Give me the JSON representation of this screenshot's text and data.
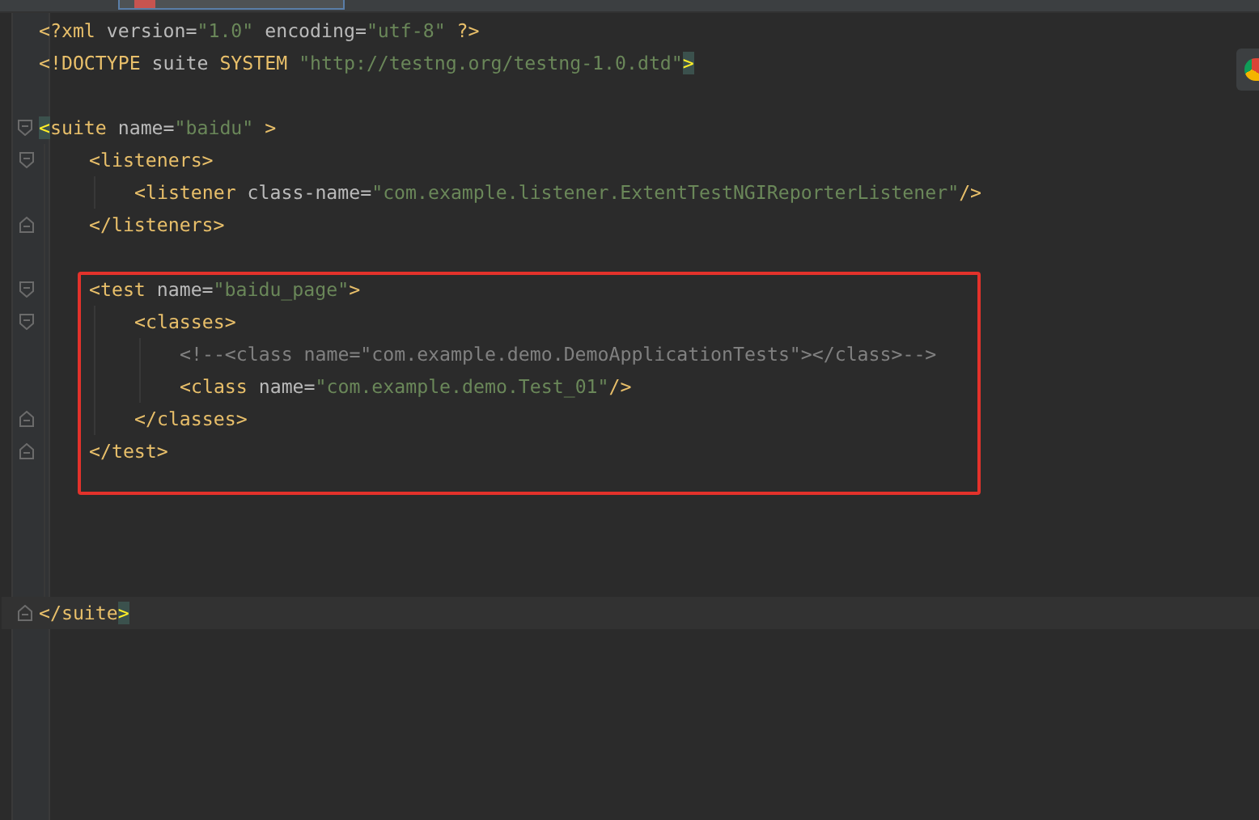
{
  "editor": {
    "lines": [
      {
        "kind": "code",
        "tokens": [
          {
            "kind": "tag",
            "text": "<?xml"
          },
          {
            "kind": "attr",
            "text": " version="
          },
          {
            "kind": "str",
            "text": "\"1.0\""
          },
          {
            "kind": "attr",
            "text": " encoding="
          },
          {
            "kind": "str",
            "text": "\"utf-8\""
          },
          {
            "kind": "tag",
            "text": " ?>"
          }
        ]
      },
      {
        "kind": "code",
        "tokens": [
          {
            "kind": "tag",
            "text": "<!DOCTYPE"
          },
          {
            "kind": "attr",
            "text": " suite"
          },
          {
            "kind": "tag",
            "text": " SYSTEM"
          },
          {
            "kind": "str",
            "text": " \"http://testng.org/testng-1.0.dtd\""
          },
          {
            "kind": "tag",
            "text": ">",
            "match": true
          }
        ]
      },
      {
        "kind": "blank"
      },
      {
        "kind": "element",
        "tokens": [
          {
            "kind": "tag",
            "text": "<",
            "match": true
          },
          {
            "kind": "tag",
            "text": "suite"
          },
          {
            "kind": "attr",
            "text": " name="
          },
          {
            "kind": "str",
            "text": "\"baidu\""
          },
          {
            "kind": "tag",
            "text": " >"
          }
        ],
        "children": [
          {
            "kind": "element",
            "tokens": [
              {
                "kind": "tag",
                "text": "<listeners>"
              }
            ],
            "children": [
              {
                "kind": "code",
                "tokens": [
                  {
                    "kind": "tag",
                    "text": "<listener"
                  },
                  {
                    "kind": "attr",
                    "text": " class-name="
                  },
                  {
                    "kind": "str",
                    "text": "\"com.example.listener.ExtentTestNGIReporterListener\""
                  },
                  {
                    "kind": "tag",
                    "text": "/>"
                  }
                ]
              }
            ],
            "close": [
              {
                "kind": "tag",
                "text": "</listeners>"
              }
            ]
          },
          {
            "kind": "blank"
          },
          {
            "kind": "element",
            "highlighted": true,
            "tokens": [
              {
                "kind": "tag",
                "text": "<test"
              },
              {
                "kind": "attr",
                "text": " name="
              },
              {
                "kind": "str",
                "text": "\"baidu_page\""
              },
              {
                "kind": "tag",
                "text": ">"
              }
            ],
            "children": [
              {
                "kind": "element",
                "tokens": [
                  {
                    "kind": "tag",
                    "text": "<classes>"
                  }
                ],
                "children": [
                  {
                    "kind": "code",
                    "tokens": [
                      {
                        "kind": "comment",
                        "text": "<!--<class name=\"com.example.demo.DemoApplicationTests\"></class>-->"
                      }
                    ]
                  },
                  {
                    "kind": "code",
                    "tokens": [
                      {
                        "kind": "tag",
                        "text": "<class"
                      },
                      {
                        "kind": "attr",
                        "text": " name="
                      },
                      {
                        "kind": "str",
                        "text": "\"com.example.demo.Test_01\""
                      },
                      {
                        "kind": "tag",
                        "text": "/>"
                      }
                    ]
                  }
                ],
                "close": [
                  {
                    "kind": "tag",
                    "text": "</classes>"
                  }
                ]
              }
            ],
            "close": [
              {
                "kind": "tag",
                "text": "</test>"
              }
            ]
          },
          {
            "kind": "blank"
          },
          {
            "kind": "blank"
          },
          {
            "kind": "blank"
          },
          {
            "kind": "blank"
          }
        ],
        "close": [
          {
            "kind": "tag",
            "text": "</suite"
          },
          {
            "kind": "tag",
            "text": ">",
            "match": true
          }
        ],
        "close_current": true
      }
    ]
  }
}
